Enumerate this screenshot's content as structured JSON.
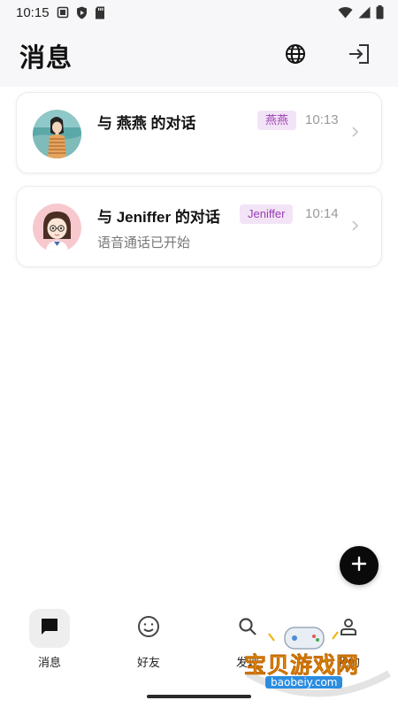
{
  "status_bar": {
    "time": "10:15",
    "icons": [
      "notification-square-icon",
      "shield-icon",
      "sd-card-icon",
      "wifi-icon",
      "signal-icon",
      "battery-icon"
    ]
  },
  "header": {
    "title": "消息",
    "actions": [
      "globe-icon",
      "logout-icon"
    ]
  },
  "conversations": [
    {
      "title": "与 燕燕 的对话",
      "tag": "燕燕",
      "time": "10:13",
      "subtitle": ""
    },
    {
      "title": "与 Jeniffer 的对话",
      "tag": "Jeniffer",
      "time": "10:14",
      "subtitle": "语音通话已开始"
    }
  ],
  "fab": {
    "icon": "plus-icon"
  },
  "bottom_nav": {
    "items": [
      {
        "label": "消息",
        "icon": "chat-icon",
        "active": true
      },
      {
        "label": "好友",
        "icon": "smiley-icon",
        "active": false
      },
      {
        "label": "发现",
        "icon": "search-icon",
        "active": false
      },
      {
        "label": "我的",
        "icon": "person-icon",
        "active": false
      }
    ]
  },
  "watermark": {
    "text": "宝贝游戏网",
    "url": "baobeiy.com"
  },
  "colors": {
    "tag_bg": "#f2e4f6",
    "tag_text": "#9a3fb0",
    "header_bg": "#f7f7f9",
    "fab_bg": "#0a0a0a"
  }
}
